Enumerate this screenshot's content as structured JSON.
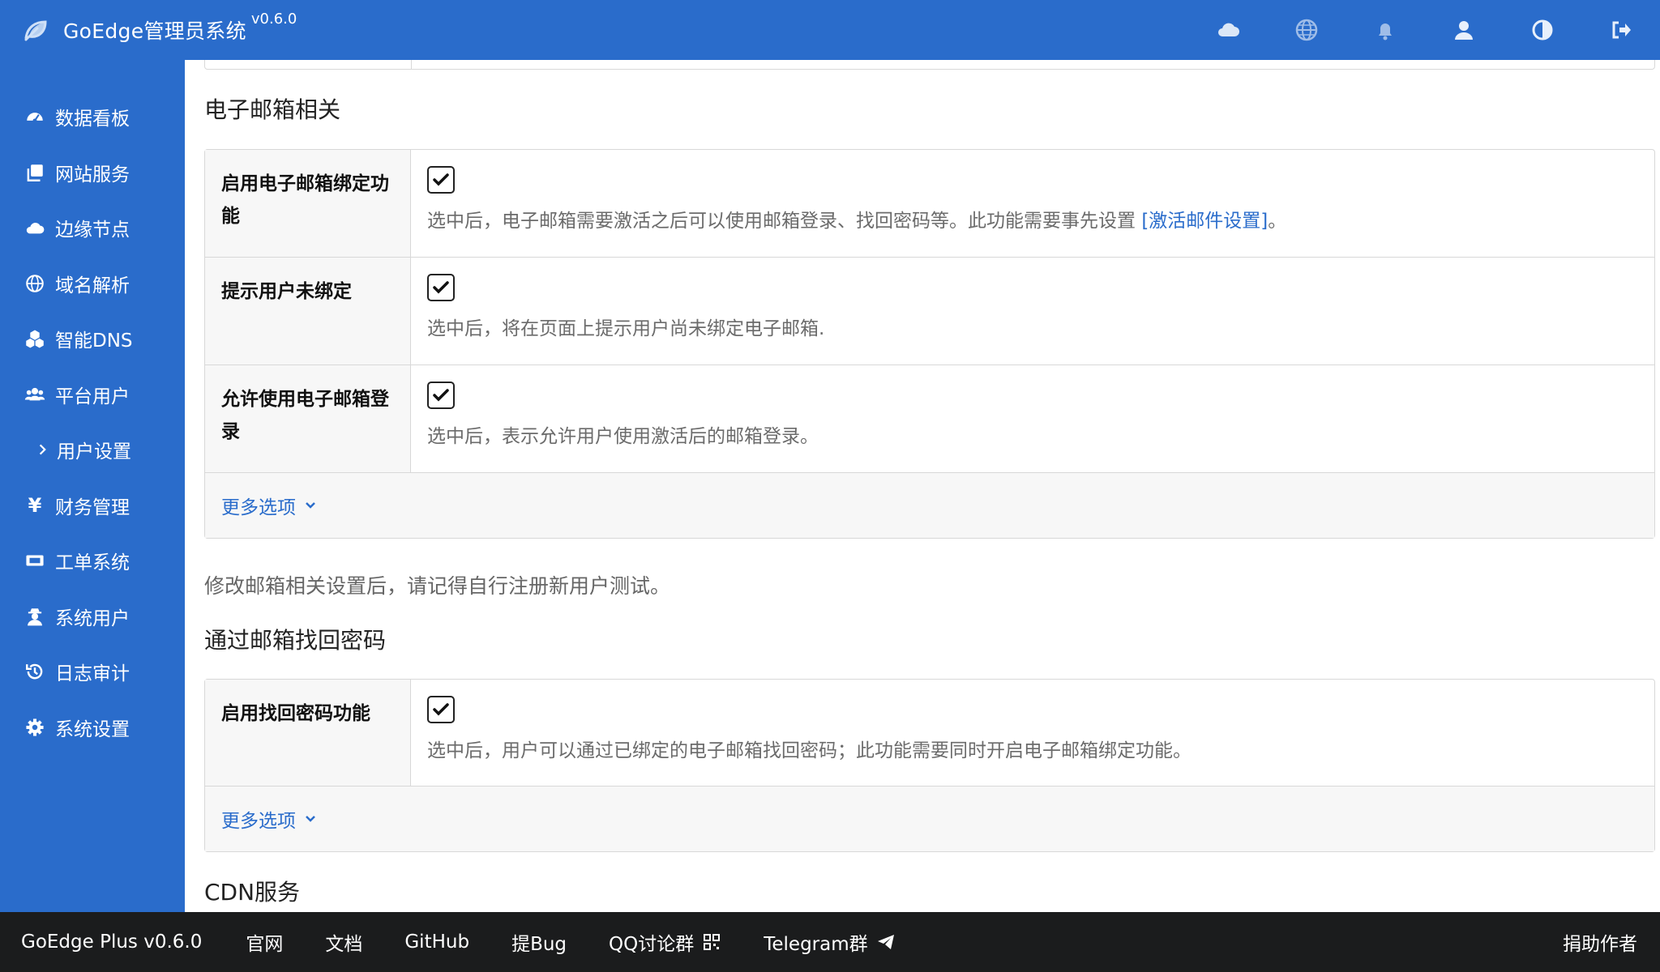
{
  "header": {
    "title": "GoEdge管理员系统",
    "version": "v0.6.0",
    "icons": [
      "cloud-icon",
      "globe-icon",
      "bell-icon",
      "user-icon",
      "contrast-icon",
      "logout-icon"
    ]
  },
  "sidebar": {
    "items": [
      {
        "label": "数据看板",
        "icon": "dashboard-icon"
      },
      {
        "label": "网站服务",
        "icon": "clone-icon"
      },
      {
        "label": "边缘节点",
        "icon": "cloud-icon"
      },
      {
        "label": "域名解析",
        "icon": "globe-icon"
      },
      {
        "label": "智能DNS",
        "icon": "cubes-icon"
      },
      {
        "label": "平台用户",
        "icon": "users-icon"
      },
      {
        "label": "用户设置",
        "icon": "chevron-right-icon"
      },
      {
        "label": "财务管理",
        "icon": "yen-icon",
        "glyph": "¥"
      },
      {
        "label": "工单系统",
        "icon": "ticket-icon"
      },
      {
        "label": "系统用户",
        "icon": "user-secret-icon"
      },
      {
        "label": "日志审计",
        "icon": "history-icon"
      },
      {
        "label": "系统设置",
        "icon": "cog-icon"
      }
    ]
  },
  "email_section": {
    "heading": "电子邮箱相关",
    "rows": [
      {
        "label": "启用电子邮箱绑定功能",
        "checked": true,
        "hint": "选中后，电子邮箱需要激活之后可以使用邮箱登录、找回密码等。此功能需要事先设置 ",
        "link": "[激活邮件设置]",
        "hint_end": "。"
      },
      {
        "label": "提示用户未绑定",
        "checked": true,
        "hint": "选中后，将在页面上提示用户尚未绑定电子邮箱."
      },
      {
        "label": "允许使用电子邮箱登录",
        "checked": true,
        "hint": "选中后，表示允许用户使用激活后的邮箱登录。"
      }
    ],
    "more_label": "更多选项",
    "note": "修改邮箱相关设置后，请记得自行注册新用户测试。"
  },
  "reset_section": {
    "heading": "通过邮箱找回密码",
    "rows": [
      {
        "label": "启用找回密码功能",
        "checked": true,
        "hint": "选中后，用户可以通过已绑定的电子邮箱找回密码；此功能需要同时开启电子邮箱绑定功能。"
      }
    ],
    "more_label": "更多选项"
  },
  "cdn_section": {
    "heading": "CDN服务"
  },
  "footer": {
    "items": [
      {
        "label": "GoEdge Plus v0.6.0"
      },
      {
        "label": "官网"
      },
      {
        "label": "文档"
      },
      {
        "label": "GitHub"
      },
      {
        "label": "提Bug"
      },
      {
        "label": "QQ讨论群",
        "icon": "qrcode-icon"
      },
      {
        "label": "Telegram群",
        "icon": "paper-plane-icon"
      }
    ],
    "donate": "捐助作者"
  },
  "colors": {
    "primary": "#2a6ccb",
    "footer_bg": "#1b1c1d",
    "hint": "#6b6b6b",
    "label_bg": "#f7f7f7"
  }
}
